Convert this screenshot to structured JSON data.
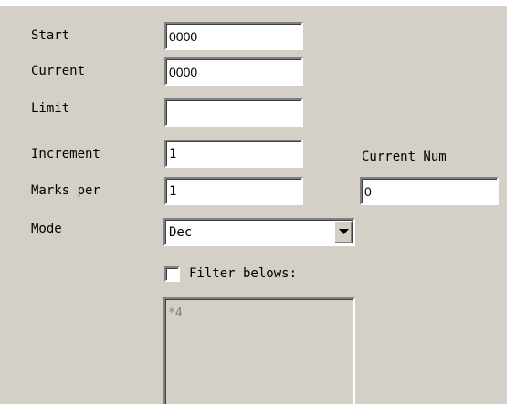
{
  "fields": {
    "start": {
      "label": "Start",
      "value": "0000"
    },
    "current": {
      "label": "Current",
      "value": "0000"
    },
    "limit": {
      "label": "Limit",
      "value": ""
    },
    "increment": {
      "label": "Increment",
      "value": "1"
    },
    "marks_per": {
      "label": "Marks per",
      "value": "1"
    },
    "mode": {
      "label": "Mode",
      "value": "Dec"
    }
  },
  "current_num": {
    "label": "Current Num",
    "value": "0"
  },
  "filter": {
    "label": "Filter belows:",
    "checked": false,
    "text": "*4"
  },
  "colors": {
    "panel": "#d4d0c8",
    "field": "#ffffff",
    "text": "#000000",
    "filter_text": "#808080"
  },
  "icons": {
    "combo_arrow": "chevron-down-icon"
  }
}
